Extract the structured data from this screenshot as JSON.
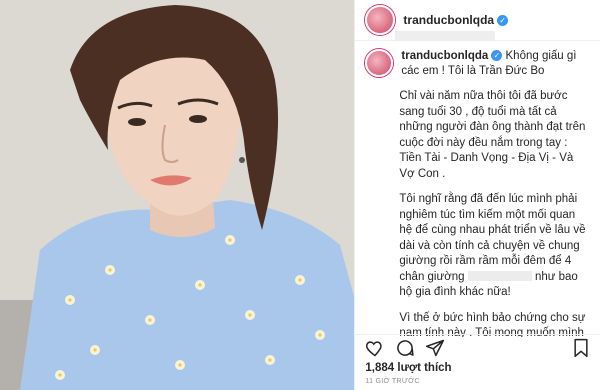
{
  "post": {
    "username": "tranducbonlqda",
    "caption_username": "tranducbonlqda",
    "caption_lead": "Không giấu gì các em ! Tôi là Trần Đức Bo",
    "paragraphs": [
      "Chỉ vài năm nữa thôi tôi đã bước sang tuổi 30 , độ tuổi mà tất cả những người đàn ông thành đạt trên cuộc đời này đều nắm trong tay : Tiền Tài - Danh Vọng - Địa Vị - Và Vợ Con .",
      "Vì thế ở bức hình bảo chứng cho sự nam tính này . Tôi mong muốn mình"
    ],
    "paragraph2_before": "Tôi nghĩ rằng đã đến lúc mình phải nghiêm túc tìm kiếm một mối quan hệ để cùng nhau phát triển về lâu về dài và còn tính cả chuyện về chung giường rồi rầm rầm mỗi đêm để 4 chân giường",
    "paragraph2_after": "như bao hộ gia đình khác nữa!",
    "likes": "1,884 lượt thích",
    "time": "11 GIỜ TRƯỚC"
  },
  "colors": {
    "verified": "#3897f0",
    "text": "#262626",
    "muted": "#8e8e8e",
    "shirt": "#a9c7ea"
  },
  "icons": [
    "verified-badge-icon",
    "heart-icon",
    "comment-icon",
    "share-icon",
    "bookmark-icon"
  ]
}
